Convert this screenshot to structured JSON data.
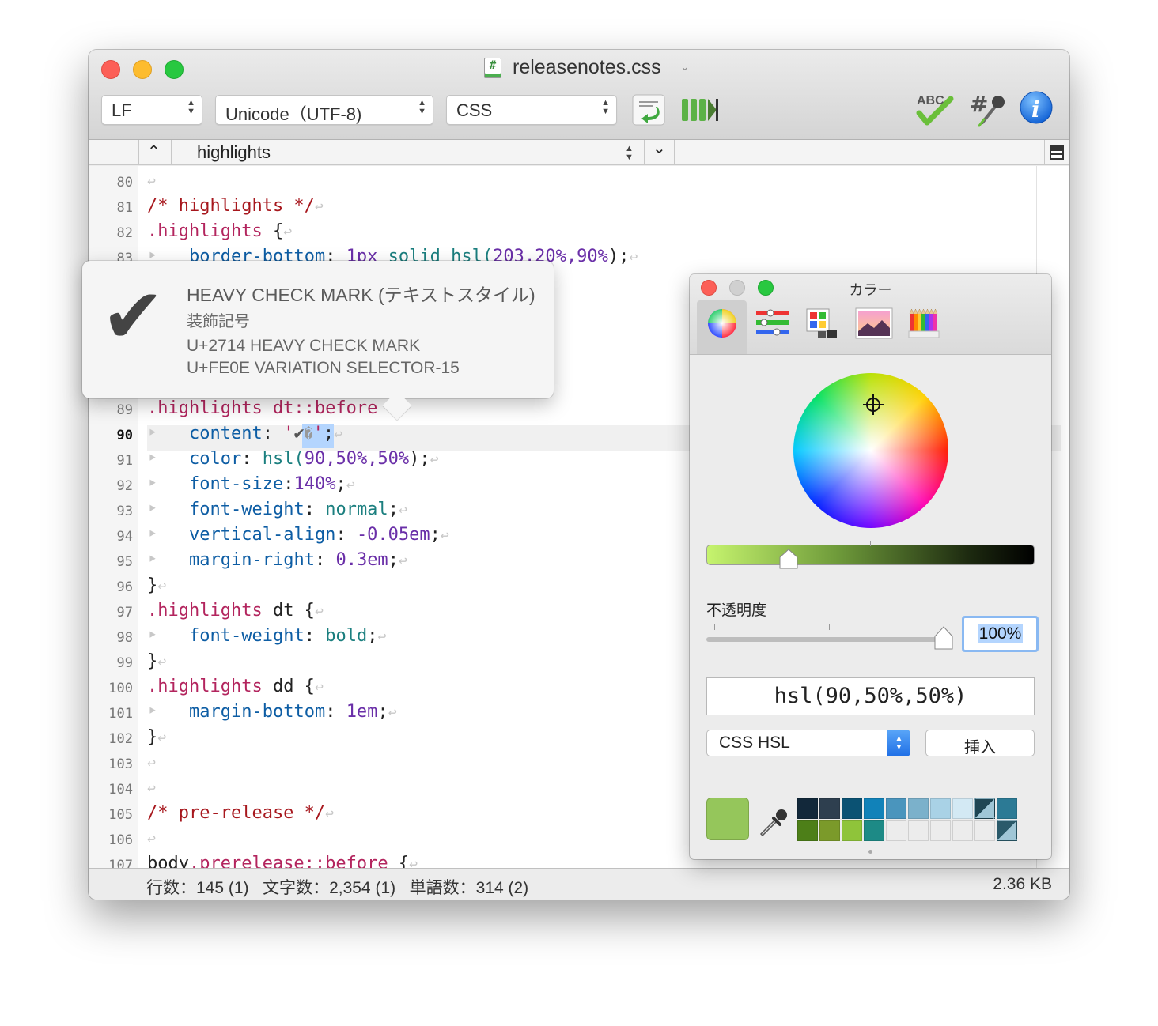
{
  "window": {
    "title": "releasenotes.css",
    "file_icon_glyph": "#"
  },
  "toolbar": {
    "line_ending": "LF",
    "encoding": "Unicode（UTF-8)",
    "syntax": "CSS",
    "icons": [
      "shift-indent-icon",
      "incompatible-chars-icon",
      "spellcheck-icon",
      "color-code-icon",
      "info-icon"
    ],
    "spellcheck_label": "ABC"
  },
  "jumpbar": {
    "outline_item": "highlights"
  },
  "editor": {
    "line_numbers": [
      "80",
      "81",
      "82",
      "83",
      "89",
      "90",
      "91",
      "92",
      "93",
      "94",
      "95",
      "96",
      "97",
      "98",
      "99",
      "100",
      "101",
      "102",
      "103",
      "104",
      "105",
      "106",
      "107"
    ],
    "current_line": "90",
    "lines": {
      "l81_comment": "/* highlights */",
      "l82_sel": ".highlights",
      "l82_brace": " {",
      "l83_prop": "border-bottom",
      "l83_colon": ": ",
      "l83_num1": "1px",
      "l83_val": " solid hsl(",
      "l83_num2": "203,20%,90%",
      "l83_end": ");",
      "l89_sel": ".highlights dt::before",
      "l89_brace": " {",
      "l90_prop": "content",
      "l90_colon": ": ",
      "l90_str_open": "'",
      "l90_char": "✔",
      "l90_vs": "�",
      "l90_str_close": "'",
      "l90_end": ";",
      "l91_prop": "color",
      "l91_colon": ": ",
      "l91_val": "hsl(",
      "l91_num": "90,50%,50%",
      "l91_end": ");",
      "l92_prop": "font-size",
      "l92_colon": ":",
      "l92_num": "140%",
      "l92_end": ";",
      "l93_prop": "font-weight",
      "l93_colon": ": ",
      "l93_val": "normal",
      "l93_end": ";",
      "l94_prop": "vertical-align",
      "l94_colon": ": ",
      "l94_num": "-0.05em",
      "l94_end": ";",
      "l95_prop": "margin-right",
      "l95_colon": ": ",
      "l95_num": "0.3em",
      "l95_end": ";",
      "l96": "}",
      "l97_sel": ".highlights",
      "l97_rest": " dt {",
      "l98_prop": "font-weight",
      "l98_colon": ": ",
      "l98_val": "bold",
      "l98_end": ";",
      "l99": "}",
      "l100_sel": ".highlights",
      "l100_rest": " dd {",
      "l101_prop": "margin-bottom",
      "l101_colon": ": ",
      "l101_num": "1em",
      "l101_end": ";",
      "l102": "}",
      "l105_comment": "/* pre-release */",
      "l107_sel_a": "body",
      "l107_sel_b": ".prerelease::before",
      "l107_brace": " {"
    },
    "newline_glyph": "↩",
    "tab_glyph": "‣"
  },
  "char_popover": {
    "glyph": "✔",
    "name": "HEAVY CHECK MARK (テキストスタイル)",
    "category": "装飾記号",
    "codepoint_1": "U+2714 HEAVY CHECK MARK",
    "codepoint_2": "U+FE0E VARIATION SELECTOR-15"
  },
  "color_panel": {
    "title": "カラー",
    "tabs": [
      "color-wheel-tab",
      "sliders-tab",
      "palettes-tab",
      "image-palettes-tab",
      "pencils-tab"
    ],
    "opacity_label": "不透明度",
    "opacity_value": "100%",
    "opacity_level": 1.0,
    "brightness_level": 0.25,
    "color_value": "hsl(90,50%,50%)",
    "format": "CSS HSL",
    "insert_label": "挿入",
    "current_color": "#95c65b",
    "swatches_row1": [
      "#12283a",
      "#2e3f4f",
      "#0b5273",
      "#1182b9",
      "#4a95bd",
      "#7bb1cb",
      "#a9d2e6",
      "#d3e9f4",
      "#1f4654",
      "#2c7a95"
    ],
    "swatches_row2": [
      "#4d7f18",
      "#7b9a2a",
      "#8fc43a",
      "#1d8a86",
      "#ececec",
      "#ececec",
      "#ececec",
      "#ececec",
      "#ececec",
      "#2a5a6a"
    ]
  },
  "status": {
    "lines_label": "行数",
    "lines_value": "145 (1)",
    "chars_label": "文字数",
    "chars_value": "2,354 (1)",
    "words_label": "単語数",
    "words_value": "314 (2)",
    "separator": "：",
    "file_size": "2.36 KB"
  }
}
